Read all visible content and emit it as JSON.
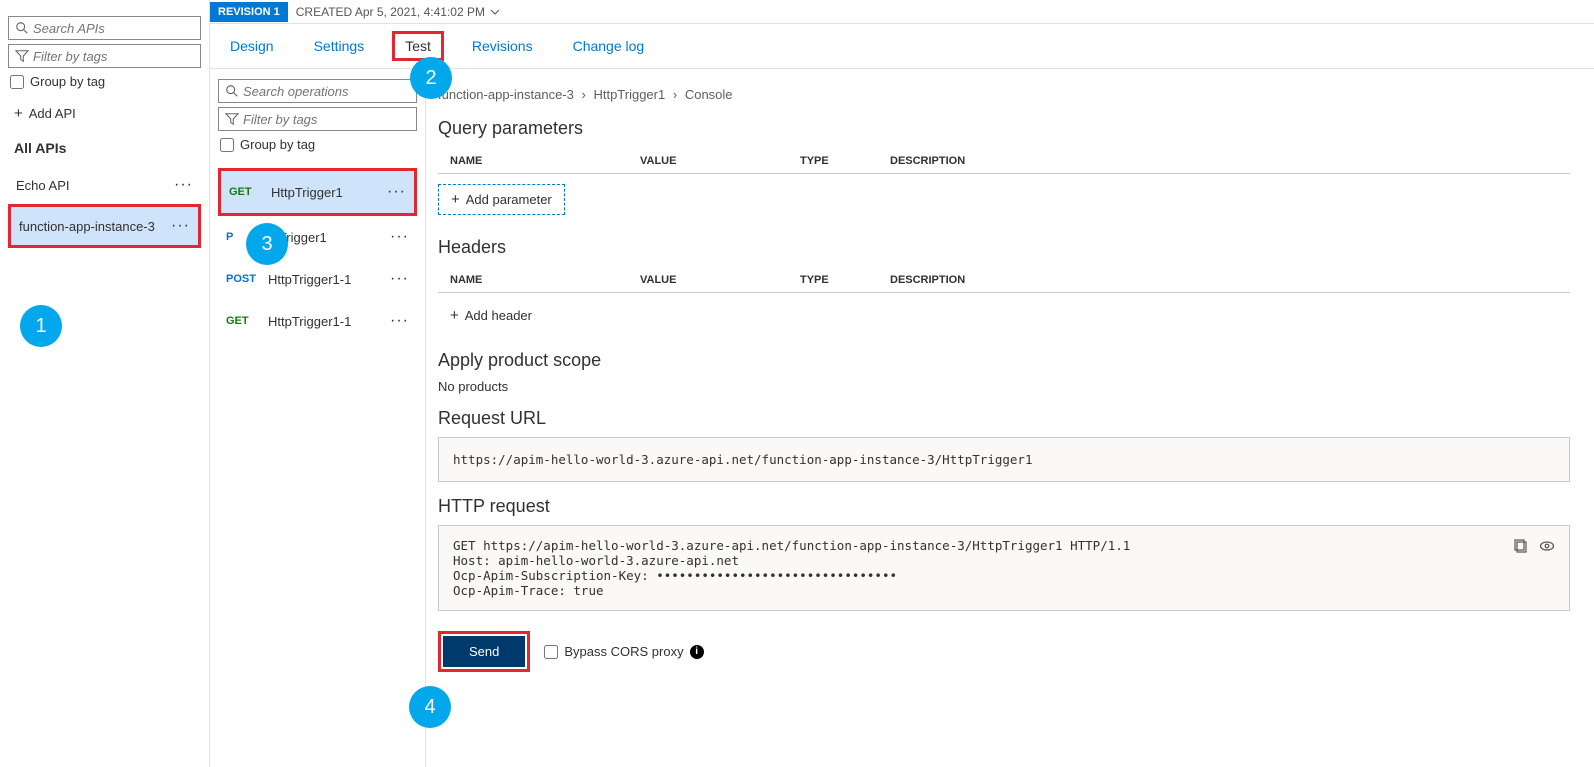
{
  "sidebar": {
    "search_placeholder": "Search APIs",
    "filter_placeholder": "Filter by tags",
    "group_label": "Group by tag",
    "add_api_label": "Add API",
    "all_apis_label": "All APIs",
    "items": [
      {
        "label": "Echo API"
      },
      {
        "label": "function-app-instance-3"
      }
    ]
  },
  "revision": {
    "badge": "REVISION 1",
    "created": "CREATED Apr 5, 2021, 4:41:02 PM"
  },
  "tabs": {
    "design": "Design",
    "settings": "Settings",
    "test": "Test",
    "revisions": "Revisions",
    "changelog": "Change log"
  },
  "ops": {
    "search_placeholder": "Search operations",
    "filter_placeholder": "Filter by tags",
    "group_label": "Group by tag",
    "items": [
      {
        "method": "GET",
        "label": "HttpTrigger1"
      },
      {
        "method": "POST",
        "label": "HttpTrigger1"
      },
      {
        "method": "POST",
        "label": "HttpTrigger1-1"
      },
      {
        "method": "GET",
        "label": "HttpTrigger1-1"
      }
    ]
  },
  "breadcrumb": {
    "a": "function-app-instance-3",
    "b": "HttpTrigger1",
    "c": "Console"
  },
  "sections": {
    "query": "Query parameters",
    "headers": "Headers",
    "apply_scope": "Apply product scope",
    "no_products": "No products",
    "request_url": "Request URL",
    "http_request": "HTTP request"
  },
  "columns": {
    "name": "NAME",
    "value": "VALUE",
    "type": "TYPE",
    "description": "DESCRIPTION"
  },
  "buttons": {
    "add_parameter": "Add parameter",
    "add_header": "Add header",
    "send": "Send",
    "bypass": "Bypass CORS proxy"
  },
  "request_url_value": "https://apim-hello-world-3.azure-api.net/function-app-instance-3/HttpTrigger1",
  "http_request_value": "GET https://apim-hello-world-3.azure-api.net/function-app-instance-3/HttpTrigger1 HTTP/1.1\nHost: apim-hello-world-3.azure-api.net\nOcp-Apim-Subscription-Key: ••••••••••••••••••••••••••••••••\nOcp-Apim-Trace: true",
  "callouts": {
    "one": "1",
    "two": "2",
    "three": "3",
    "four": "4"
  }
}
